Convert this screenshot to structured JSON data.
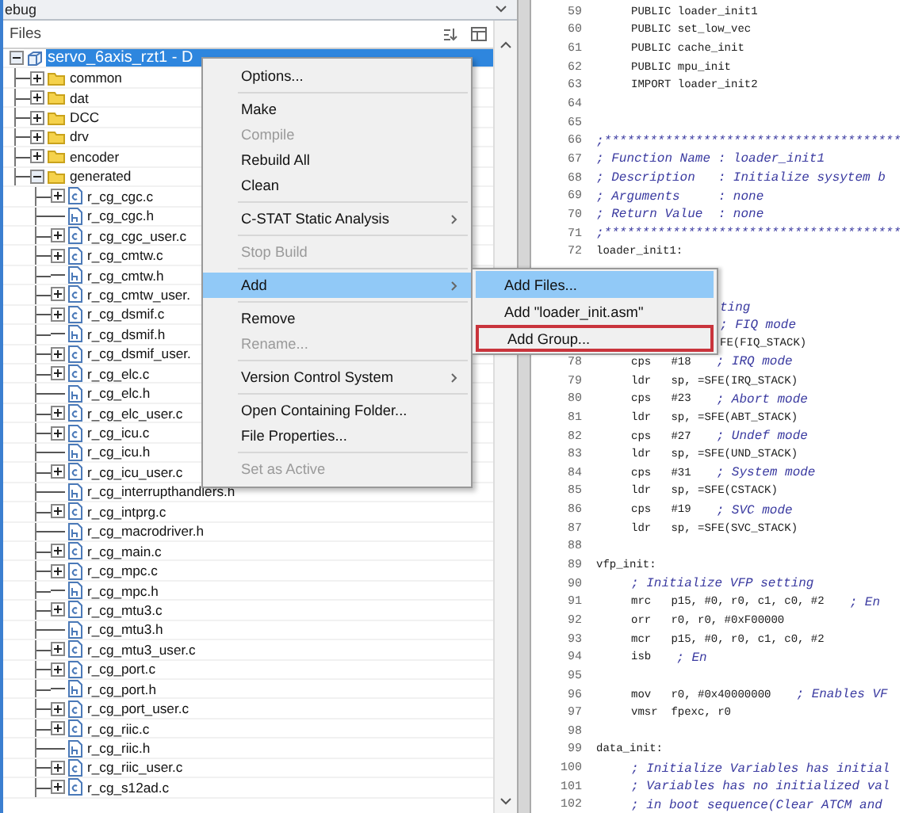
{
  "workspace": {
    "title": "ebug",
    "column": "Files",
    "project": {
      "label": "servo_6axis_rzt1 - D",
      "selected": true,
      "expanded": true,
      "children": [
        {
          "kind": "folder",
          "label": "common",
          "expanded": false
        },
        {
          "kind": "folder",
          "label": "dat",
          "expanded": false
        },
        {
          "kind": "folder",
          "label": "DCC",
          "expanded": false
        },
        {
          "kind": "folder",
          "label": "drv",
          "expanded": false
        },
        {
          "kind": "folder",
          "label": "encoder",
          "expanded": false
        },
        {
          "kind": "folder",
          "label": "generated",
          "expanded": true,
          "children": [
            {
              "kind": "source",
              "label": "r_cg_cgc.c",
              "expanded": false
            },
            {
              "kind": "header",
              "label": "r_cg_cgc.h"
            },
            {
              "kind": "source",
              "label": "r_cg_cgc_user.c",
              "expanded": false
            },
            {
              "kind": "source",
              "label": "r_cg_cmtw.c",
              "expanded": false
            },
            {
              "kind": "header",
              "label": "r_cg_cmtw.h"
            },
            {
              "kind": "source",
              "label": "r_cg_cmtw_user.",
              "expanded": false
            },
            {
              "kind": "source",
              "label": "r_cg_dsmif.c",
              "expanded": false
            },
            {
              "kind": "header",
              "label": "r_cg_dsmif.h"
            },
            {
              "kind": "source",
              "label": "r_cg_dsmif_user.",
              "expanded": false
            },
            {
              "kind": "source",
              "label": "r_cg_elc.c",
              "expanded": false
            },
            {
              "kind": "header",
              "label": "r_cg_elc.h"
            },
            {
              "kind": "source",
              "label": "r_cg_elc_user.c",
              "expanded": false
            },
            {
              "kind": "source",
              "label": "r_cg_icu.c",
              "expanded": false
            },
            {
              "kind": "header",
              "label": "r_cg_icu.h"
            },
            {
              "kind": "source",
              "label": "r_cg_icu_user.c",
              "expanded": false
            },
            {
              "kind": "header",
              "label": "r_cg_interrupthandlers.h"
            },
            {
              "kind": "source",
              "label": "r_cg_intprg.c",
              "expanded": false
            },
            {
              "kind": "header",
              "label": "r_cg_macrodriver.h"
            },
            {
              "kind": "source",
              "label": "r_cg_main.c",
              "expanded": false
            },
            {
              "kind": "source",
              "label": "r_cg_mpc.c",
              "expanded": false
            },
            {
              "kind": "header",
              "label": "r_cg_mpc.h"
            },
            {
              "kind": "source",
              "label": "r_cg_mtu3.c",
              "expanded": false
            },
            {
              "kind": "header",
              "label": "r_cg_mtu3.h"
            },
            {
              "kind": "source",
              "label": "r_cg_mtu3_user.c",
              "expanded": false
            },
            {
              "kind": "source",
              "label": "r_cg_port.c",
              "expanded": false
            },
            {
              "kind": "header",
              "label": "r_cg_port.h"
            },
            {
              "kind": "source",
              "label": "r_cg_port_user.c",
              "expanded": false
            },
            {
              "kind": "source",
              "label": "r_cg_riic.c",
              "expanded": false
            },
            {
              "kind": "header",
              "label": "r_cg_riic.h"
            },
            {
              "kind": "source",
              "label": "r_cg_riic_user.c",
              "expanded": false
            },
            {
              "kind": "source",
              "label": "r_cg_s12ad.c",
              "expanded": false
            }
          ]
        }
      ]
    }
  },
  "context_menu": {
    "items": [
      {
        "kind": "item",
        "label": "Options...",
        "disabled": false,
        "selected": false,
        "submenu": false
      },
      {
        "kind": "separator"
      },
      {
        "kind": "item",
        "label": "Make",
        "disabled": false,
        "selected": false,
        "submenu": false
      },
      {
        "kind": "item",
        "label": "Compile",
        "disabled": true,
        "selected": false,
        "submenu": false
      },
      {
        "kind": "item",
        "label": "Rebuild All",
        "disabled": false,
        "selected": false,
        "submenu": false
      },
      {
        "kind": "item",
        "label": "Clean",
        "disabled": false,
        "selected": false,
        "submenu": false
      },
      {
        "kind": "separator"
      },
      {
        "kind": "item",
        "label": "C-STAT Static Analysis",
        "disabled": false,
        "selected": false,
        "submenu": true
      },
      {
        "kind": "separator"
      },
      {
        "kind": "item",
        "label": "Stop Build",
        "disabled": true,
        "selected": false,
        "submenu": false
      },
      {
        "kind": "separator"
      },
      {
        "kind": "item",
        "label": "Add",
        "disabled": false,
        "selected": true,
        "submenu": true
      },
      {
        "kind": "separator"
      },
      {
        "kind": "item",
        "label": "Remove",
        "disabled": false,
        "selected": false,
        "submenu": false
      },
      {
        "kind": "item",
        "label": "Rename...",
        "disabled": true,
        "selected": false,
        "submenu": false
      },
      {
        "kind": "separator"
      },
      {
        "kind": "item",
        "label": "Version Control System",
        "disabled": false,
        "selected": false,
        "submenu": true
      },
      {
        "kind": "separator"
      },
      {
        "kind": "item",
        "label": "Open Containing Folder...",
        "disabled": false,
        "selected": false,
        "submenu": false
      },
      {
        "kind": "item",
        "label": "File Properties...",
        "disabled": false,
        "selected": false,
        "submenu": false
      },
      {
        "kind": "separator"
      },
      {
        "kind": "item",
        "label": "Set as Active",
        "disabled": true,
        "selected": false,
        "submenu": false
      }
    ]
  },
  "submenu": {
    "items": [
      {
        "label": "Add Files...",
        "selected": true,
        "annotated": false
      },
      {
        "label": "Add \"loader_init.asm\"",
        "selected": false,
        "annotated": false
      },
      {
        "label": "Add Group...",
        "selected": false,
        "annotated": true
      }
    ]
  },
  "editor": {
    "lines": [
      {
        "kind": "line",
        "number": "59",
        "indent": true,
        "code": "PUBLIC loader_init1"
      },
      {
        "kind": "line",
        "number": "60",
        "indent": true,
        "code": "PUBLIC set_low_vec"
      },
      {
        "kind": "line",
        "number": "61",
        "indent": true,
        "code": "PUBLIC cache_init"
      },
      {
        "kind": "line",
        "number": "62",
        "indent": true,
        "code": "PUBLIC mpu_init"
      },
      {
        "kind": "line",
        "number": "63",
        "indent": true,
        "code": "IMPORT loader_init2"
      },
      {
        "kind": "line",
        "number": "64"
      },
      {
        "kind": "line",
        "number": "65"
      },
      {
        "kind": "line",
        "number": "66",
        "indent": false,
        "comment": ";***************************************"
      },
      {
        "kind": "line",
        "number": "67",
        "indent": false,
        "comment": "; Function Name : loader_init1"
      },
      {
        "kind": "line",
        "number": "68",
        "indent": false,
        "comment": "; Description   : Initialize sysytem b"
      },
      {
        "kind": "line",
        "number": "69",
        "indent": false,
        "comment": "; Arguments     : none"
      },
      {
        "kind": "line",
        "number": "70",
        "indent": false,
        "comment": "; Return Value  : none"
      },
      {
        "kind": "line",
        "number": "71",
        "indent": false,
        "comment": ";***************************************"
      },
      {
        "kind": "line",
        "number": "72",
        "indent": false,
        "code": "loader_init1:"
      },
      {
        "kind": "covered"
      },
      {
        "kind": "covered"
      },
      {
        "kind": "covered",
        "comment": "ting"
      },
      {
        "kind": "covered",
        "comment": "; FIQ mode"
      },
      {
        "kind": "covered",
        "code": "FE(FIQ_STACK)"
      },
      {
        "kind": "line",
        "number": "78",
        "indent": true,
        "code": "cps   #18",
        "comment": "; IRQ mode"
      },
      {
        "kind": "line",
        "number": "79",
        "indent": true,
        "code": "ldr   sp, =SFE(IRQ_STACK)"
      },
      {
        "kind": "line",
        "number": "80",
        "indent": true,
        "code": "cps   #23",
        "comment": "; Abort mode"
      },
      {
        "kind": "line",
        "number": "81",
        "indent": true,
        "code": "ldr   sp, =SFE(ABT_STACK)"
      },
      {
        "kind": "line",
        "number": "82",
        "indent": true,
        "code": "cps   #27",
        "comment": "; Undef mode"
      },
      {
        "kind": "line",
        "number": "83",
        "indent": true,
        "code": "ldr   sp, =SFE(UND_STACK)"
      },
      {
        "kind": "line",
        "number": "84",
        "indent": true,
        "code": "cps   #31",
        "comment": "; System mode"
      },
      {
        "kind": "line",
        "number": "85",
        "indent": true,
        "code": "ldr   sp, =SFE(CSTACK)"
      },
      {
        "kind": "line",
        "number": "86",
        "indent": true,
        "code": "cps   #19",
        "comment": "; SVC mode"
      },
      {
        "kind": "line",
        "number": "87",
        "indent": true,
        "code": "ldr   sp, =SFE(SVC_STACK)"
      },
      {
        "kind": "line",
        "number": "88"
      },
      {
        "kind": "line",
        "number": "89",
        "indent": false,
        "code": "vfp_init:"
      },
      {
        "kind": "line",
        "number": "90",
        "indent": true,
        "comment": "; Initialize VFP setting"
      },
      {
        "kind": "line",
        "number": "91",
        "indent": true,
        "code": "mrc   p15, #0, r0, c1, c0, #2",
        "comment": "; En"
      },
      {
        "kind": "line",
        "number": "92",
        "indent": true,
        "code": "orr   r0, r0, #0xF00000"
      },
      {
        "kind": "line",
        "number": "93",
        "indent": true,
        "code": "mcr   p15, #0, r0, c1, c0, #2"
      },
      {
        "kind": "line",
        "number": "94",
        "indent": true,
        "code": "isb",
        "comment": "; En"
      },
      {
        "kind": "line",
        "number": "95"
      },
      {
        "kind": "line",
        "number": "96",
        "indent": true,
        "code": "mov   r0, #0x40000000",
        "comment": "; Enables VF"
      },
      {
        "kind": "line",
        "number": "97",
        "indent": true,
        "code": "vmsr  fpexc, r0"
      },
      {
        "kind": "line",
        "number": "98"
      },
      {
        "kind": "line",
        "number": "99",
        "indent": false,
        "code": "data_init:"
      },
      {
        "kind": "line",
        "number": "100",
        "indent": true,
        "comment": "; Initialize Variables has initial"
      },
      {
        "kind": "line",
        "number": "101",
        "indent": true,
        "comment": "; Variables has no initialized val"
      },
      {
        "kind": "line",
        "number": "102",
        "indent": true,
        "comment": "; in boot sequence(Clear ATCM and"
      }
    ]
  }
}
